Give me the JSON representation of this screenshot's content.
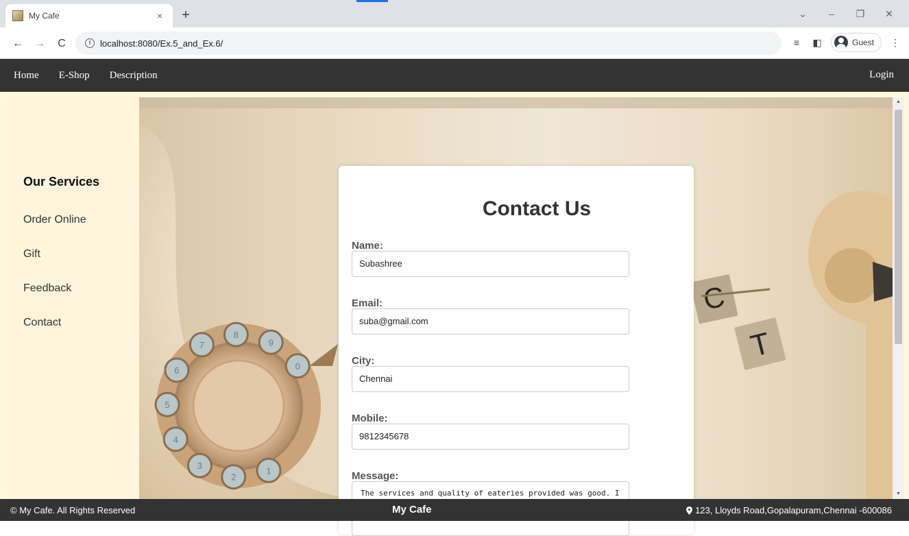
{
  "browser": {
    "tab_title": "My Cafe",
    "tab_close": "×",
    "new_tab": "+",
    "url": "localhost:8080/Ex.5_and_Ex.6/",
    "profile": "Guest",
    "icons": [
      "back-arrow-icon",
      "forward-arrow-icon",
      "reload-icon",
      "info-icon",
      "reading-list-icon",
      "side-panel-icon",
      "profile-avatar-icon",
      "menu-dots-icon"
    ]
  },
  "nav": {
    "items": [
      "Home",
      "E-Shop",
      "Description"
    ],
    "login": "Login"
  },
  "sidebar": {
    "title": "Our Services",
    "items": [
      "Order Online",
      "Gift",
      "Feedback",
      "Contact"
    ]
  },
  "form": {
    "title": "Contact Us",
    "fields": [
      {
        "label": "Name:",
        "value": "Subashree"
      },
      {
        "label": "Email:",
        "value": "suba@gmail.com"
      },
      {
        "label": "City:",
        "value": "Chennai"
      },
      {
        "label": "Mobile:",
        "value": "9812345678"
      }
    ],
    "message": {
      "label": "Message:",
      "value": "The services and quality of eateries provided was good. I would like to know the procedure for taking orders for special occasion from your café."
    }
  },
  "footer": {
    "copyright": "© My Cafe. All Rights Reserved",
    "brand": "My Cafe",
    "address": "123, Lloyds Road,Gopalapuram,Chennai -600086"
  },
  "hero_tiles": [
    "C",
    "T"
  ],
  "dial_numbers": [
    "1",
    "2",
    "3",
    "4",
    "5",
    "6",
    "7",
    "8",
    "9",
    "0"
  ],
  "colors": {
    "nav_bg": "#333333",
    "sidebar_bg": "#fff5dc",
    "accent": "#1a73e8"
  }
}
